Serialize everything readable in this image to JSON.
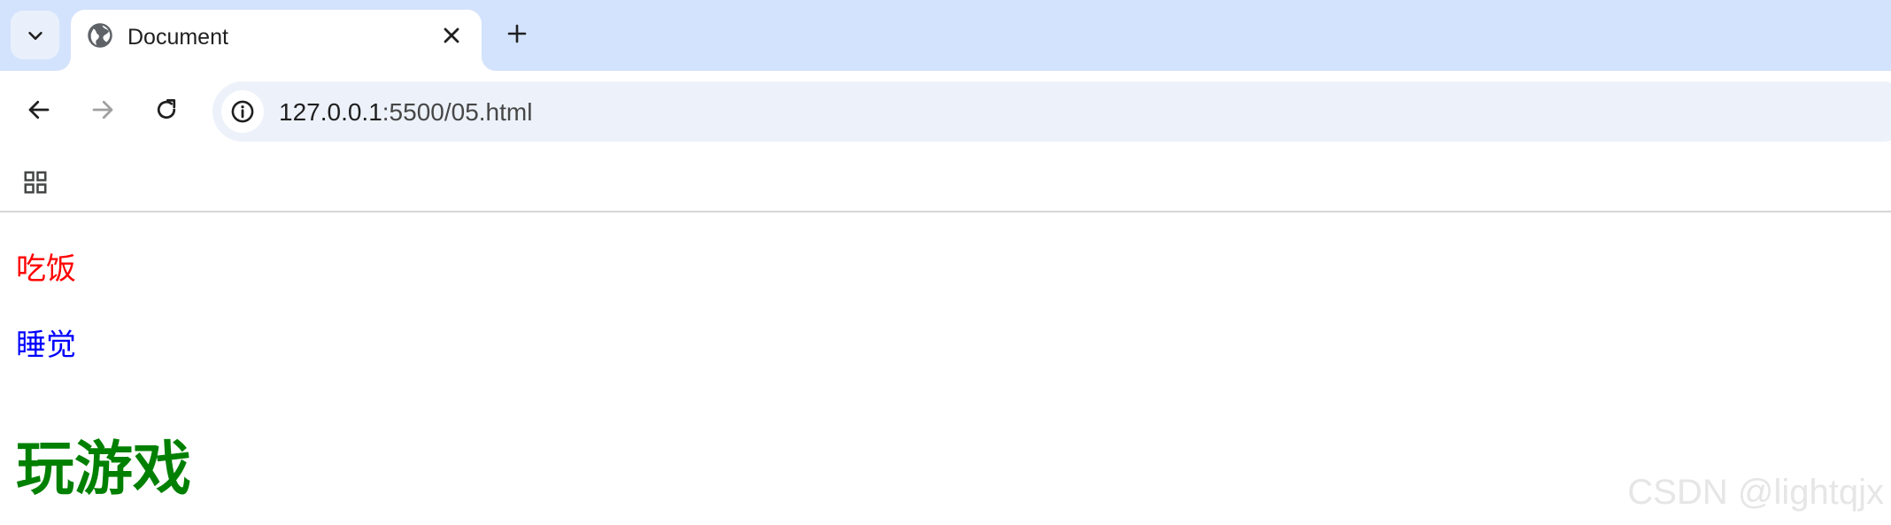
{
  "browser": {
    "tab": {
      "title": "Document",
      "favicon": "globe-icon"
    },
    "address_bar": {
      "url_host": "127.0.0.1",
      "url_rest": ":5500/05.html"
    },
    "icons": {
      "tab_search": "chevron-down-icon",
      "tab_close": "close-icon",
      "new_tab": "plus-icon",
      "back": "arrow-left-icon",
      "forward": "arrow-right-icon",
      "reload": "reload-icon",
      "site_info": "info-icon",
      "apps": "apps-grid-icon"
    },
    "colors": {
      "tab_strip": "#d3e3fd",
      "omnibox": "#edf2fa"
    }
  },
  "page": {
    "line1": {
      "text": "吃饭",
      "color": "#ff0000"
    },
    "line2": {
      "text": "睡觉",
      "color": "#0000ff"
    },
    "heading": {
      "text": "玩游戏",
      "color": "#008000"
    }
  },
  "watermark": "CSDN @lightqjx"
}
